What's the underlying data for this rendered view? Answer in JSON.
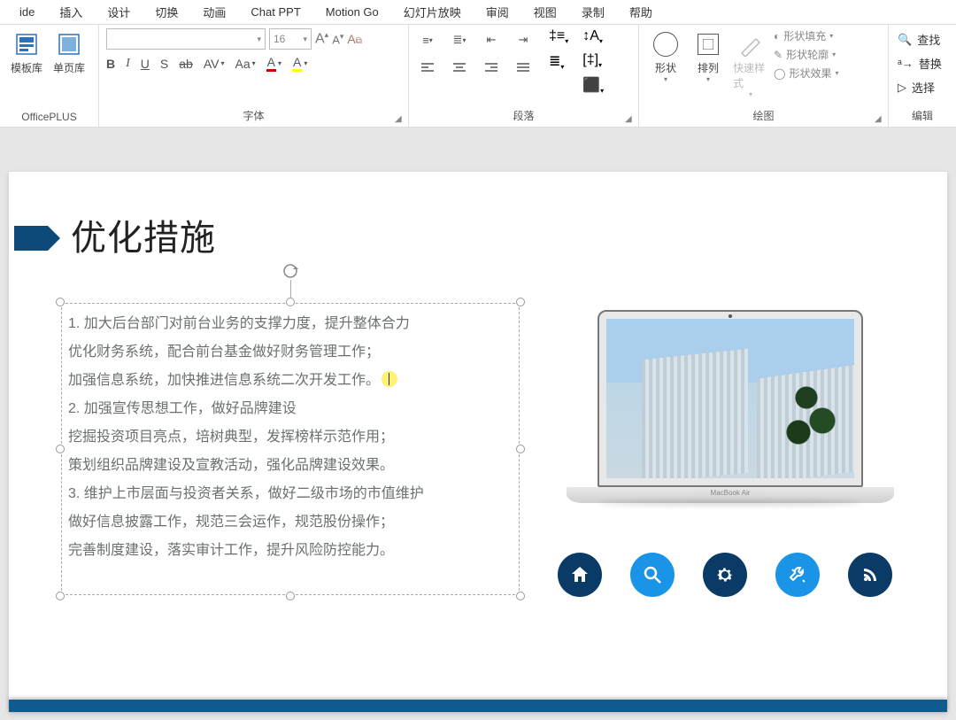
{
  "menubar": [
    "ide",
    "插入",
    "设计",
    "切换",
    "动画",
    "Chat PPT",
    "Motion Go",
    "幻灯片放映",
    "审阅",
    "视图",
    "录制",
    "帮助"
  ],
  "ribbon": {
    "officeplus": {
      "label": "OfficePLUS",
      "template_lib": "模板库",
      "single_page_lib": "单页库"
    },
    "font": {
      "label": "字体",
      "name_placeholder": "",
      "size_value": "16",
      "buttons": [
        "B",
        "I",
        "U",
        "S",
        "ab",
        "AV",
        "Aa",
        "A"
      ],
      "grow": "A",
      "shrink": "A",
      "clear": "A"
    },
    "paragraph": {
      "label": "段落"
    },
    "drawing": {
      "label": "绘图",
      "shapes": "形状",
      "arrange": "排列",
      "quick_styles": "快速样式",
      "shape_fill": "形状填充",
      "shape_outline": "形状轮廓",
      "shape_effects": "形状效果"
    },
    "editing": {
      "label": "编辑",
      "find": "查找",
      "replace": "替换",
      "select": "选择"
    }
  },
  "slide": {
    "title": "优化措施",
    "lines": [
      "1.   加大后台部门对前台业务的支撑力度，提升整体合力",
      "优化财务系统，配合前台基金做好财务管理工作；",
      "加强信息系统，加快推进信息系统二次开发工作。",
      "2.   加强宣传思想工作，做好品牌建设",
      "挖掘投资项目亮点，培树典型，发挥榜样示范作用；",
      "策划组织品牌建设及宣教活动，强化品牌建设效果。",
      "3.   维护上市层面与投资者关系，做好二级市场的市值维护",
      "做好信息披露工作，规范三会运作，规范股份操作；",
      "完善制度建设，落实审计工作，提升风险防控能力。"
    ],
    "cursor_line_index": 2,
    "laptop_label": "MacBook Air",
    "icons": [
      "home",
      "search",
      "gear",
      "wrench",
      "rss"
    ]
  }
}
